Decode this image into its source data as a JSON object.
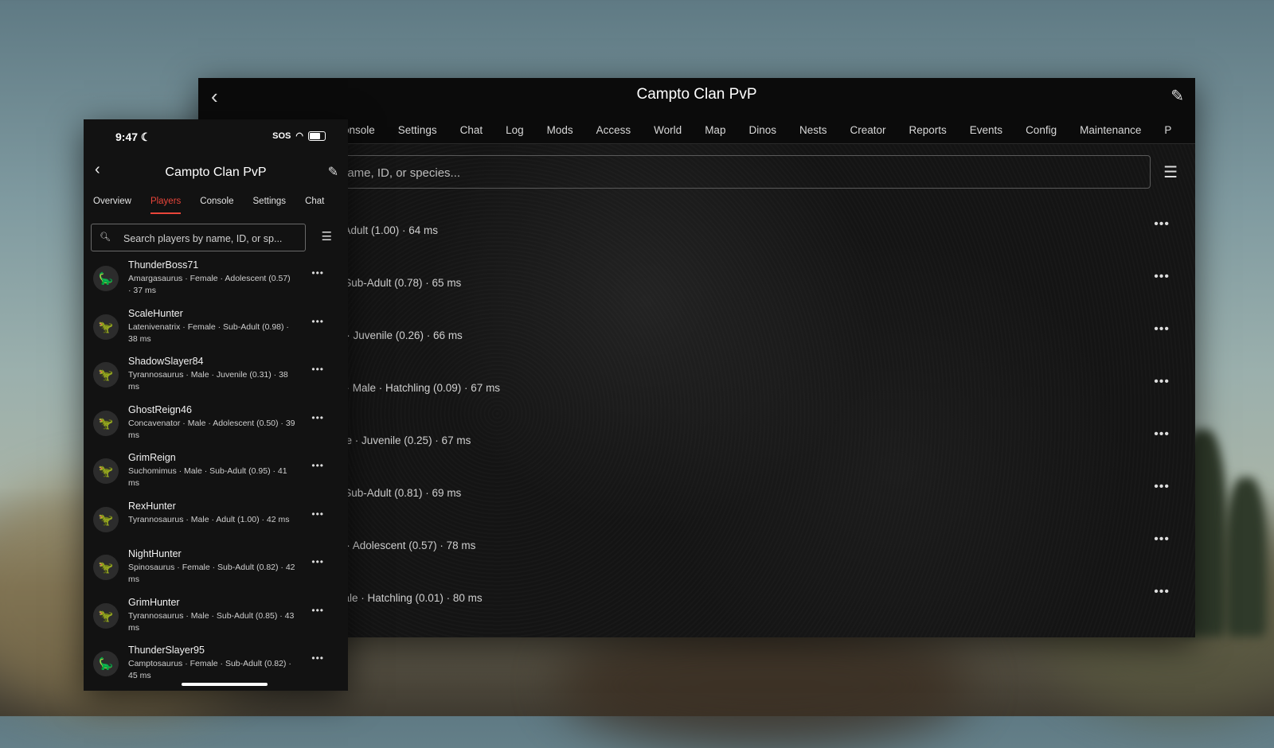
{
  "tablet": {
    "title": "Campto Clan PvP",
    "back_icon": "‹",
    "edit_icon": "✎",
    "tabs": [
      "onsole",
      "Settings",
      "Chat",
      "Log",
      "Mods",
      "Access",
      "World",
      "Map",
      "Dinos",
      "Nests",
      "Creator",
      "Reports",
      "Events",
      "Config",
      "Maintenance",
      "P"
    ],
    "search_placeholder": "name, ID, or species...",
    "rows": [
      "· Adult (1.00) · 64 ms",
      "· Sub-Adult (0.78) · 65 ms",
      "e · Juvenile (0.26) · 66 ms",
      "s · Male · Hatchling (0.09) · 67 ms",
      "ale · Juvenile (0.25) · 67 ms",
      "· Sub-Adult (0.81) · 69 ms",
      "e · Adolescent (0.57) · 78 ms",
      "nale · Hatchling (0.01) · 80 ms"
    ]
  },
  "phone": {
    "time": "9:47",
    "sos": "SOS",
    "title": "Campto Clan PvP",
    "tabs": [
      "Overview",
      "Players",
      "Console",
      "Settings",
      "Chat"
    ],
    "active_tab": "Players",
    "search_placeholder": "Search players by name, ID, or sp...",
    "players": [
      {
        "name": "ThunderBoss71",
        "detail": "Amargasaurus · Female · Adolescent (0.57) · 37 ms",
        "avatar": "🦕",
        "color": "#5aa0d8"
      },
      {
        "name": "ScaleHunter",
        "detail": "Latenivenatrix · Female · Sub-Adult (0.98) · 38 ms",
        "avatar": "🦖",
        "color": "#e0a030"
      },
      {
        "name": "ShadowSlayer84",
        "detail": "Tyrannosaurus · Male · Juvenile (0.31) · 38 ms",
        "avatar": "🦖",
        "color": "#8a4fd8"
      },
      {
        "name": "GhostReign46",
        "detail": "Concavenator · Male · Adolescent (0.50) · 39 ms",
        "avatar": "🦖",
        "color": "#e8a0a0"
      },
      {
        "name": "GrimReign",
        "detail": "Suchomimus · Male · Sub-Adult (0.95) · 41 ms",
        "avatar": "🦖",
        "color": "#8ab0d0"
      },
      {
        "name": "RexHunter",
        "detail": "Tyrannosaurus · Male · Adult (1.00) · 42 ms",
        "avatar": "🦖",
        "color": "#8a4fd8"
      },
      {
        "name": "NightHunter",
        "detail": "Spinosaurus · Female · Sub-Adult (0.82) · 42 ms",
        "avatar": "🦖",
        "color": "#60c060"
      },
      {
        "name": "GrimHunter",
        "detail": "Tyrannosaurus · Male · Sub-Adult (0.85) · 43 ms",
        "avatar": "🦖",
        "color": "#8a4fd8"
      },
      {
        "name": "ThunderSlayer95",
        "detail": "Camptosaurus · Female · Sub-Adult (0.82) · 45 ms",
        "avatar": "🦕",
        "color": "#e8c030"
      }
    ]
  }
}
